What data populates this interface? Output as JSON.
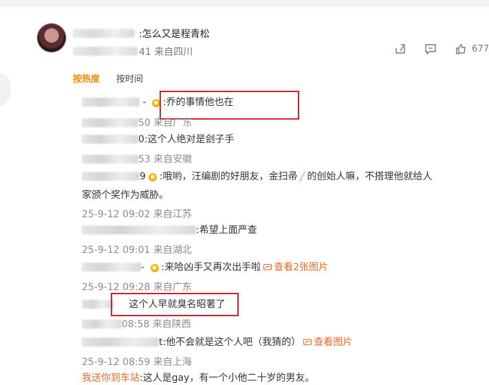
{
  "main_comment": {
    "text": ":怎么又是程青松",
    "meta": "41 来自四川",
    "likes": "677"
  },
  "tabs": [
    {
      "label": "按热度"
    },
    {
      "label": "按时间"
    }
  ],
  "replies": [
    {
      "text": ":乔的事情他也在",
      "meta": "50 来自广东"
    },
    {
      "text": "0:这个人绝对是刽子手",
      "meta": "53 来自安徽"
    },
    {
      "prefix": "9",
      "text": ":哦哟，汪编剧的好朋友，金扫帚",
      "text2": "的创始人嘛，不搭理他就给人",
      "text3": "家颁个奖作为威胁。",
      "meta": "25-9-12 09:02 来自江苏"
    },
    {
      "text": ":希望上面严查",
      "meta": "25-9-12 09:01 来自湖北"
    },
    {
      "text": ":来哈凶手又再次出手啦",
      "view": "查看2张图片",
      "meta": "25-9-12 09:28 来自广东"
    },
    {
      "text": "这个人早就臭名昭著了",
      "meta": "08:58 来自陕西"
    },
    {
      "text": "t:他不会就是这个人吧（我猜的）",
      "view": "查看图片",
      "meta": "25-9-12 08:59 来自上海"
    },
    {
      "link": "我送你到车站",
      "text": ":这人是gay，有一个小他二十岁的男友。"
    }
  ]
}
